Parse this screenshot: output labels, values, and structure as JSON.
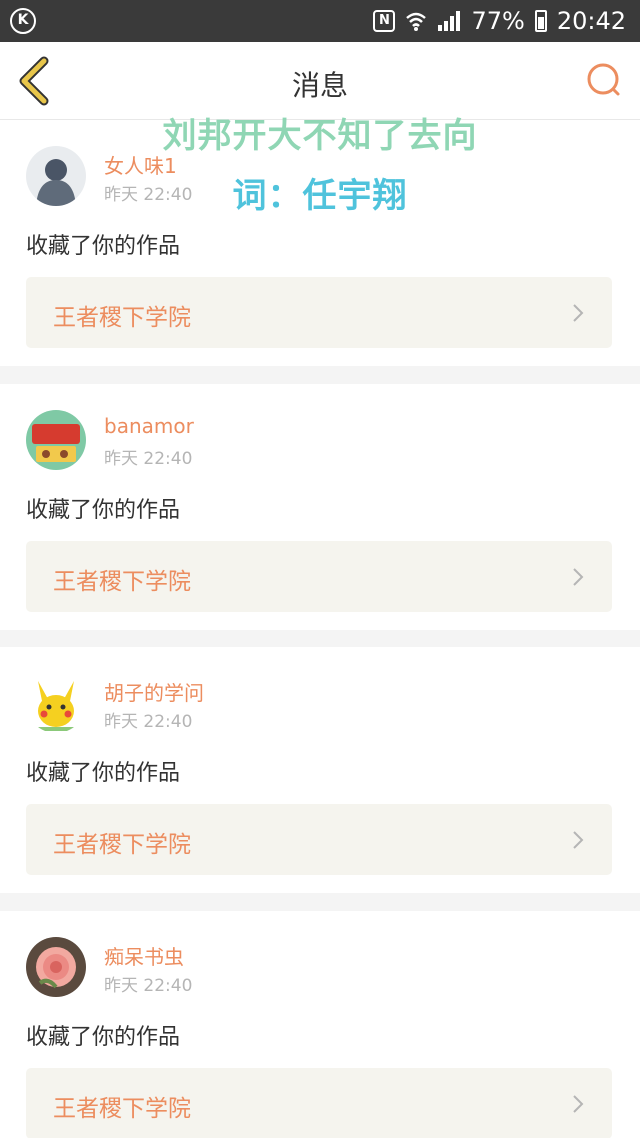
{
  "status_bar": {
    "k_icon_label": "K",
    "nfc_label": "N",
    "battery": "77%",
    "time": "20:42"
  },
  "header": {
    "title": "消息"
  },
  "overlay": {
    "line1": "刘邦开大不知了去向",
    "line2": "词：任宇翔"
  },
  "messages": [
    {
      "username": "女人味1",
      "time": "昨天 22:40",
      "action": "收藏了你的作品",
      "work_title": "王者稷下学院"
    },
    {
      "username": "banamor",
      "time": "昨天 22:40",
      "action": "收藏了你的作品",
      "work_title": "王者稷下学院"
    },
    {
      "username": "胡子的学问",
      "time": "昨天 22:40",
      "action": "收藏了你的作品",
      "work_title": "王者稷下学院"
    },
    {
      "username": "痴呆书虫",
      "time": "昨天 22:40",
      "action": "收藏了你的作品",
      "work_title": "王者稷下学院"
    }
  ],
  "colors": {
    "accent": "#ec8d5f",
    "back_arrow": "#e8c64a",
    "status_bar": "#3a3a3a",
    "work_bg": "#f5f4ee",
    "overlay_line1": "#8fd6b4",
    "overlay_line2": "#4fc3dc"
  },
  "icons": {
    "back": "back-arrow-icon",
    "search": "search-icon",
    "chevron": "chevron-right-icon"
  }
}
